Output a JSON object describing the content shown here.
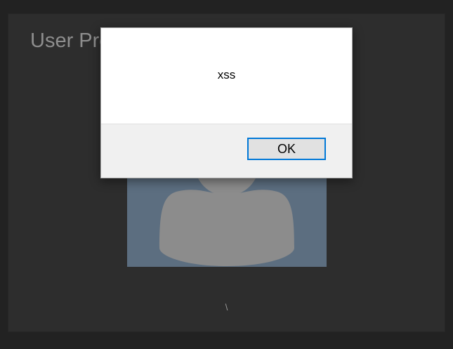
{
  "page": {
    "title": "User Profile",
    "username": "\\"
  },
  "avatar": {
    "icon": "user-silhouette-icon",
    "background_color": "#5c6e80",
    "figure_color": "#8c8c8c"
  },
  "dialog": {
    "message": "xss",
    "ok_label": "OK",
    "accent_color": "#0078d7"
  }
}
